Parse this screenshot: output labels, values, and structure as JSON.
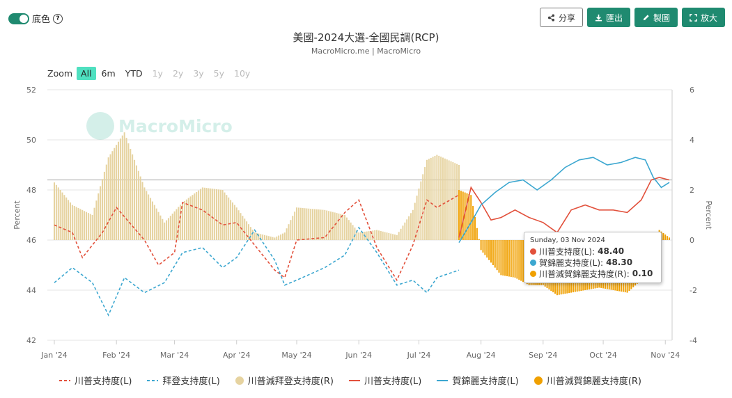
{
  "toggle": {
    "label": "底色"
  },
  "toolbar": {
    "share": "分享",
    "export": "匯出",
    "make": "製圖",
    "enlarge": "放大"
  },
  "zoom": {
    "label": "Zoom",
    "options": [
      "All",
      "6m",
      "YTD",
      "1y",
      "2y",
      "3y",
      "5y",
      "10y"
    ],
    "active": "All"
  },
  "chart_data": {
    "type": "line",
    "title": "美國-2024大選-全國民調(RCP)",
    "subtitle": "MacroMicro.me | MacroMicro",
    "watermark": "MacroMicro",
    "x_tick_labels": [
      "Jan '24",
      "Feb '24",
      "Mar '24",
      "Apr '24",
      "May '24",
      "Jun '24",
      "Jul '24",
      "Aug '24",
      "Sep '24",
      "Oct '24",
      "Nov '24"
    ],
    "x_range": [
      "2024-01-01",
      "2024-11-03"
    ],
    "left_axis": {
      "label": "Percent",
      "ylim": [
        42,
        52
      ],
      "ticks": [
        "42",
        "44",
        "46",
        "48",
        "50",
        "52"
      ]
    },
    "right_axis": {
      "label": "Percent",
      "ylim": [
        -4,
        6
      ],
      "ticks": [
        "-4",
        "-2",
        "0",
        "2",
        "4",
        "6"
      ]
    },
    "grid": true,
    "legend_position": "bottom",
    "colors": {
      "trump": "#e2513c",
      "biden": "#3ca7d0",
      "harris": "#3ca7d0",
      "spread_biden": "#e6d3a0",
      "spread_harris": "#f0a000"
    },
    "series": [
      {
        "name": "川普支持度(L)",
        "axis": "left",
        "style": "dashed",
        "color": "#e2513c",
        "x": [
          "2024-01-01",
          "2024-01-10",
          "2024-01-15",
          "2024-01-25",
          "2024-02-01",
          "2024-02-15",
          "2024-02-22",
          "2024-03-01",
          "2024-03-05",
          "2024-03-15",
          "2024-03-25",
          "2024-04-01",
          "2024-04-10",
          "2024-04-20",
          "2024-04-25",
          "2024-05-01",
          "2024-05-15",
          "2024-05-25",
          "2024-06-01",
          "2024-06-10",
          "2024-06-20",
          "2024-06-28",
          "2024-07-05",
          "2024-07-10",
          "2024-07-21"
        ],
        "y": [
          46.6,
          46.3,
          45.3,
          46.3,
          47.3,
          46.0,
          45.0,
          45.5,
          47.5,
          47.2,
          46.6,
          46.7,
          45.8,
          44.8,
          44.5,
          46.0,
          46.1,
          47.1,
          47.6,
          45.7,
          44.4,
          45.8,
          47.6,
          47.3,
          47.8
        ]
      },
      {
        "name": "拜登支持度(L)",
        "axis": "left",
        "style": "dashed",
        "color": "#3ca7d0",
        "x": [
          "2024-01-01",
          "2024-01-10",
          "2024-01-20",
          "2024-01-28",
          "2024-02-05",
          "2024-02-15",
          "2024-02-25",
          "2024-03-05",
          "2024-03-15",
          "2024-03-25",
          "2024-04-01",
          "2024-04-10",
          "2024-04-20",
          "2024-04-25",
          "2024-05-01",
          "2024-05-15",
          "2024-05-25",
          "2024-06-01",
          "2024-06-10",
          "2024-06-20",
          "2024-06-28",
          "2024-07-05",
          "2024-07-10",
          "2024-07-21"
        ],
        "y": [
          44.3,
          44.9,
          44.3,
          43.0,
          44.5,
          43.9,
          44.3,
          45.5,
          45.7,
          44.9,
          45.3,
          46.4,
          45.2,
          44.2,
          44.4,
          44.9,
          45.4,
          46.5,
          45.5,
          44.2,
          44.4,
          43.9,
          44.5,
          44.8
        ]
      },
      {
        "name": "川普減拜登支持度(R)",
        "axis": "right",
        "style": "column",
        "color": "#e6d3a0",
        "x": [
          "2024-01-01",
          "2024-01-10",
          "2024-01-20",
          "2024-01-28",
          "2024-02-05",
          "2024-02-15",
          "2024-02-25",
          "2024-03-05",
          "2024-03-15",
          "2024-03-25",
          "2024-04-01",
          "2024-04-10",
          "2024-04-20",
          "2024-04-25",
          "2024-05-01",
          "2024-05-15",
          "2024-05-25",
          "2024-06-01",
          "2024-06-10",
          "2024-06-20",
          "2024-06-28",
          "2024-07-05",
          "2024-07-10",
          "2024-07-21"
        ],
        "y": [
          2.3,
          1.4,
          1.0,
          3.3,
          4.3,
          2.1,
          0.7,
          1.5,
          2.1,
          2.0,
          1.3,
          0.3,
          0.1,
          0.3,
          1.3,
          1.2,
          1.0,
          0.3,
          0.4,
          0.2,
          1.2,
          3.2,
          3.4,
          3.0
        ]
      },
      {
        "name": "川普支持度(L)",
        "axis": "left",
        "style": "solid",
        "color": "#e2513c",
        "x": [
          "2024-07-21",
          "2024-07-27",
          "2024-08-01",
          "2024-08-06",
          "2024-08-11",
          "2024-08-18",
          "2024-08-25",
          "2024-09-01",
          "2024-09-08",
          "2024-09-15",
          "2024-09-22",
          "2024-09-29",
          "2024-10-06",
          "2024-10-13",
          "2024-10-20",
          "2024-10-25",
          "2024-10-29",
          "2024-11-03"
        ],
        "y": [
          46.1,
          48.1,
          47.5,
          46.8,
          46.9,
          47.2,
          46.9,
          46.7,
          46.3,
          47.2,
          47.4,
          47.2,
          47.2,
          47.1,
          47.6,
          48.4,
          48.5,
          48.4
        ]
      },
      {
        "name": "賀錦麗支持度(L)",
        "axis": "left",
        "style": "solid",
        "color": "#3ca7d0",
        "x": [
          "2024-07-21",
          "2024-07-27",
          "2024-08-01",
          "2024-08-08",
          "2024-08-15",
          "2024-08-22",
          "2024-08-29",
          "2024-09-05",
          "2024-09-12",
          "2024-09-19",
          "2024-09-26",
          "2024-10-03",
          "2024-10-10",
          "2024-10-17",
          "2024-10-22",
          "2024-10-26",
          "2024-10-30",
          "2024-11-03"
        ],
        "y": [
          45.9,
          46.7,
          47.4,
          47.9,
          48.3,
          48.4,
          48.0,
          48.4,
          48.9,
          49.2,
          49.3,
          49.0,
          49.1,
          49.3,
          49.2,
          48.5,
          48.1,
          48.3
        ]
      },
      {
        "name": "川普減賀錦麗支持度(R)",
        "axis": "right",
        "style": "column",
        "color": "#f0a000",
        "x": [
          "2024-07-21",
          "2024-07-27",
          "2024-08-01",
          "2024-08-06",
          "2024-08-11",
          "2024-08-18",
          "2024-08-25",
          "2024-09-01",
          "2024-09-08",
          "2024-09-15",
          "2024-09-22",
          "2024-09-29",
          "2024-10-06",
          "2024-10-13",
          "2024-10-20",
          "2024-10-25",
          "2024-10-29",
          "2024-11-03"
        ],
        "y": [
          2.0,
          1.8,
          -0.4,
          -0.9,
          -1.4,
          -1.5,
          -1.8,
          -1.8,
          -2.2,
          -2.1,
          -2.0,
          -1.9,
          -2.0,
          -2.1,
          -1.6,
          -0.3,
          0.4,
          0.1
        ]
      }
    ],
    "tooltip": {
      "date": "Sunday, 03 Nov 2024",
      "rows": [
        {
          "label": "川普支持度(L):",
          "value": "48.40",
          "color": "#e2513c"
        },
        {
          "label": "賀錦麗支持度(L):",
          "value": "48.30",
          "color": "#3ca7d0"
        },
        {
          "label": "川普減賀錦麗支持度(R):",
          "value": "0.10",
          "color": "#f0a000"
        }
      ]
    }
  }
}
